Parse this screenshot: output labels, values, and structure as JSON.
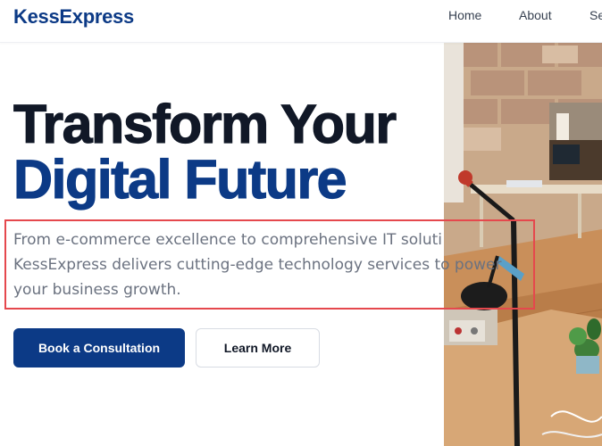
{
  "header": {
    "brand": "KessExpress",
    "nav": [
      {
        "label": "Home"
      },
      {
        "label": "About"
      },
      {
        "label": "Se"
      }
    ]
  },
  "hero": {
    "headline_line1": "Transform Your",
    "headline_line2": "Digital Future",
    "lead_lines": [
      "From e-commerce excellence to comprehensive IT soluti",
      "KessExpress delivers cutting-edge technology services to power",
      "your business growth."
    ],
    "primary_button": "Book a Consultation",
    "secondary_button": "Learn More"
  },
  "colors": {
    "brand": "#0c3a86",
    "headline_dark": "#111827",
    "body_text": "#6b7280",
    "highlight": "#e5484d"
  }
}
